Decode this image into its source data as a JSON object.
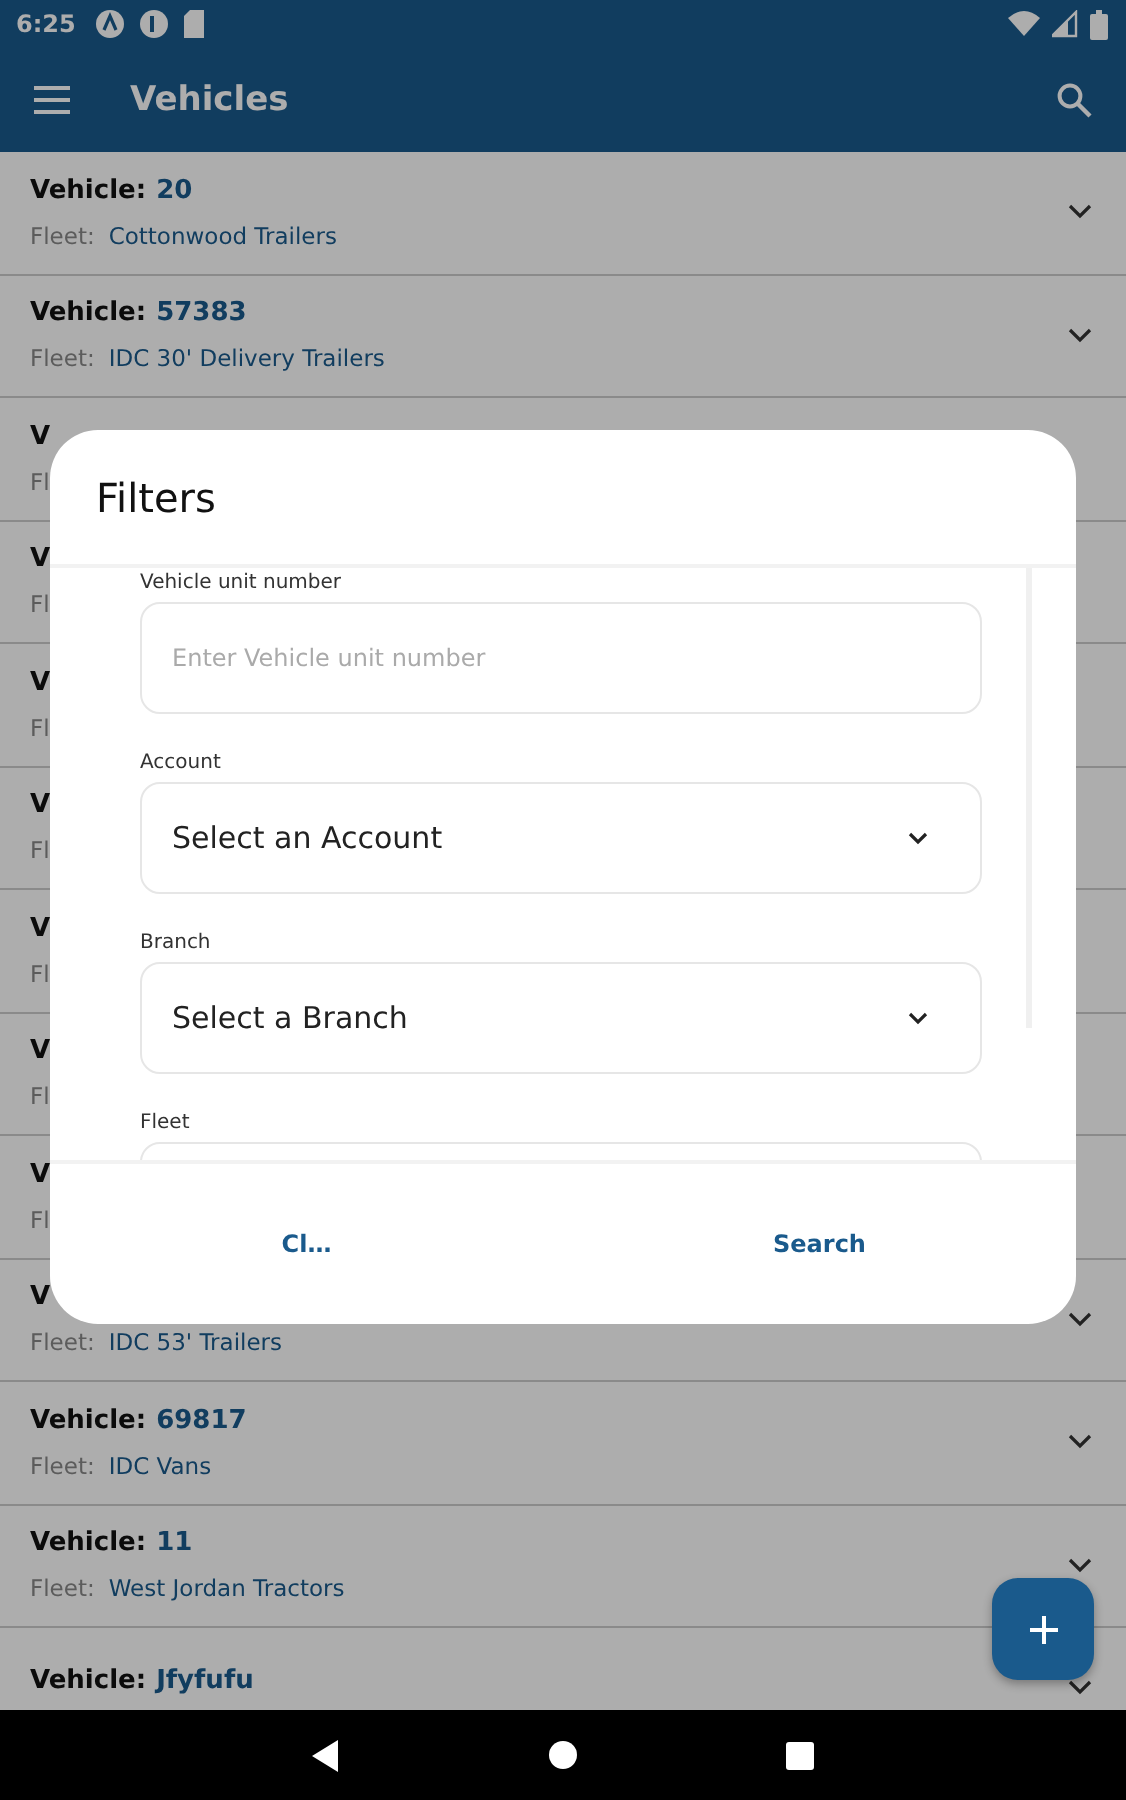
{
  "status_bar": {
    "time": "6:25"
  },
  "app_bar": {
    "title": "Vehicles"
  },
  "vehicles": [
    {
      "label": "Vehicle:",
      "number": "20",
      "fleet_label": "Fleet:",
      "fleet": "Cottonwood Trailers",
      "chevron": true
    },
    {
      "label": "Vehicle:",
      "number": "57383",
      "fleet_label": "Fleet:",
      "fleet": "IDC 30' Delivery Trailers",
      "chevron": true
    },
    {
      "label": "V",
      "fleet_label": "Fl",
      "chevron": false
    },
    {
      "label": "V",
      "fleet_label": "Fl",
      "chevron": false
    },
    {
      "label": "V",
      "fleet_label": "Fl",
      "chevron": false
    },
    {
      "label": "V",
      "fleet_label": "Fl",
      "chevron": false
    },
    {
      "label": "V",
      "fleet_label": "Fl",
      "chevron": false
    },
    {
      "label": "V",
      "fleet_label": "Fl",
      "chevron": false
    },
    {
      "label": "V",
      "fleet_label": "Fl",
      "chevron": false
    },
    {
      "label": "V",
      "fleet_label": "Fleet:",
      "fleet": "IDC 53' Trailers",
      "chevron": true
    },
    {
      "label": "Vehicle:",
      "number": "69817",
      "fleet_label": "Fleet:",
      "fleet": "IDC Vans",
      "chevron": true
    },
    {
      "label": "Vehicle:",
      "number": "11",
      "fleet_label": "Fleet:",
      "fleet": "West Jordan Tractors",
      "chevron": true
    },
    {
      "label": "Vehicle:",
      "number": "Jfyfufu",
      "chevron": true
    }
  ],
  "dialog": {
    "title": "Filters",
    "fields": [
      {
        "kind": "input",
        "label": "Vehicle unit number",
        "placeholder": "Enter Vehicle unit number"
      },
      {
        "kind": "select",
        "label": "Account",
        "value": "Select an Account"
      },
      {
        "kind": "select",
        "label": "Branch",
        "value": "Select a Branch"
      },
      {
        "kind": "select",
        "label": "Fleet"
      }
    ],
    "buttons": [
      "Cl…",
      "Search"
    ]
  }
}
